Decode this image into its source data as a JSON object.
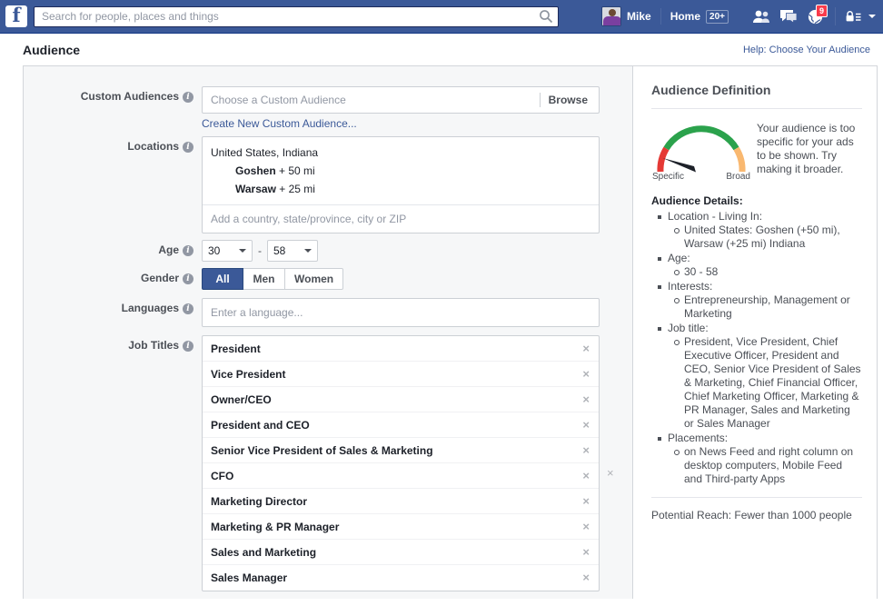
{
  "topbar": {
    "logo": "f",
    "search": {
      "placeholder": "Search for people, places and things",
      "value": "",
      "icon": "search-icon"
    },
    "user_name": "Mike",
    "home_label": "Home",
    "home_badge": "20+",
    "icons": [
      {
        "name": "friend-requests-icon",
        "badge": ""
      },
      {
        "name": "messages-icon",
        "badge": ""
      },
      {
        "name": "notifications-globe-icon",
        "badge": "9"
      },
      {
        "name": "privacy-lock-icon",
        "badge": ""
      }
    ],
    "colors": {
      "bar": "#3b5998",
      "badge_red": "#fa3c4c"
    }
  },
  "page": {
    "title": "Audience",
    "help_link": "Help: Choose Your Audience"
  },
  "form": {
    "custom_audiences": {
      "label": "Custom Audiences",
      "placeholder": "Choose a Custom Audience",
      "value": "",
      "browse_label": "Browse",
      "create_link": "Create New Custom Audience..."
    },
    "locations": {
      "label": "Locations",
      "country_line": "United States, Indiana",
      "entries": [
        {
          "city": "Goshen",
          "radius": "+ 50 mi"
        },
        {
          "city": "Warsaw",
          "radius": "+ 25 mi"
        }
      ],
      "placeholder": "Add a country, state/province, city or ZIP",
      "value": ""
    },
    "age": {
      "label": "Age",
      "min": "30",
      "max": "58",
      "separator": "-"
    },
    "gender": {
      "label": "Gender",
      "options": [
        "All",
        "Men",
        "Women"
      ],
      "selected": "All"
    },
    "languages": {
      "label": "Languages",
      "placeholder": "Enter a language...",
      "value": ""
    },
    "job_titles": {
      "label": "Job Titles",
      "items": [
        "President",
        "Vice President",
        "Owner/CEO",
        "President and CEO",
        "Senior Vice President of Sales & Marketing",
        "CFO",
        "Marketing Director",
        "Marketing & PR Manager",
        "Sales and Marketing",
        "Sales Manager"
      ],
      "remove_glyph": "×"
    }
  },
  "sidebar": {
    "title": "Audience Definition",
    "gauge": {
      "low_label": "Specific",
      "high_label": "Broad",
      "needle_position": "specific",
      "colors": {
        "low": "#e53935",
        "mid": "#2ba24c",
        "high": "#f9b870"
      }
    },
    "message": "Your audience is too specific for your ads to be shown. Try making it broader.",
    "details_title": "Audience Details:",
    "details": [
      {
        "label": "Location - Living In:",
        "values": [
          "United States: Goshen (+50 mi), Warsaw (+25 mi) Indiana"
        ]
      },
      {
        "label": "Age:",
        "values": [
          "30 - 58"
        ]
      },
      {
        "label": "Interests:",
        "values": [
          "Entrepreneurship, Management or Marketing"
        ]
      },
      {
        "label": "Job title:",
        "values": [
          "President, Vice President, Chief Executive Officer, President and CEO, Senior Vice President of Sales & Marketing, Chief Financial Officer, Chief Marketing Officer, Marketing & PR Manager, Sales and Marketing or Sales Manager"
        ]
      },
      {
        "label": "Placements:",
        "values": [
          "on News Feed and right column on desktop computers, Mobile Feed and Third-party Apps"
        ]
      }
    ],
    "potential_reach": "Potential Reach: Fewer than 1000 people"
  }
}
